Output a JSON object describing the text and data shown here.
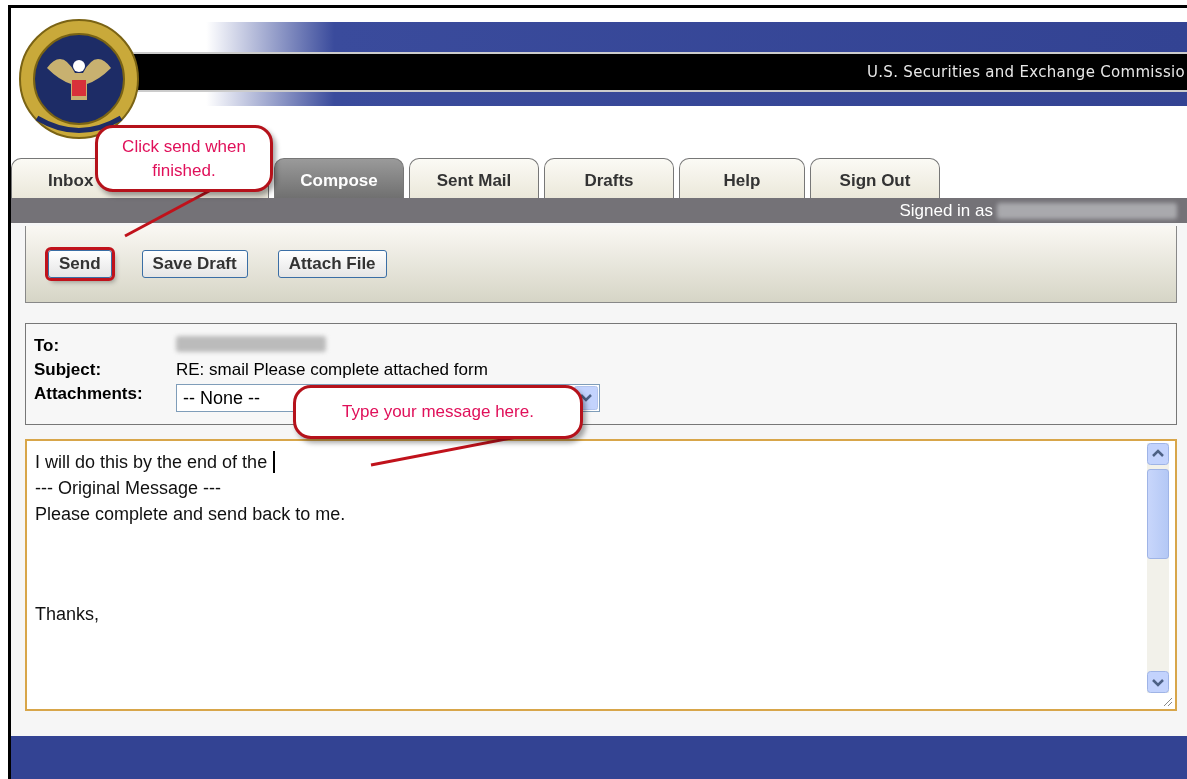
{
  "header": {
    "title": "U.S. Securities and Exchange Commissio"
  },
  "tabs": [
    {
      "label": "Inbox",
      "selected": false
    },
    {
      "label": "Compose",
      "selected": true
    },
    {
      "label": "Sent Mail",
      "selected": false
    },
    {
      "label": "Drafts",
      "selected": false
    },
    {
      "label": "Help",
      "selected": false
    },
    {
      "label": "Sign Out",
      "selected": false
    }
  ],
  "status": {
    "signed_in_label": "Signed in as"
  },
  "toolbar": {
    "buttons": [
      {
        "label": "Send",
        "highlighted": true
      },
      {
        "label": "Save Draft",
        "highlighted": false
      },
      {
        "label": "Attach File",
        "highlighted": false
      }
    ]
  },
  "fields": [
    {
      "label": "To:",
      "kind": "blurred"
    },
    {
      "label": "Subject:",
      "kind": "text",
      "value": "RE: smail Please complete attached form"
    },
    {
      "label": "Attachments:",
      "kind": "select",
      "value": "-- None --"
    }
  ],
  "message": {
    "lines": [
      {
        "text": "I will do this by the end of the",
        "kind": "typing"
      },
      {
        "text": "--- Original Message ---",
        "kind": "plain"
      },
      {
        "text": "Please complete and send back to me.",
        "kind": "plain"
      },
      {
        "text": "Thanks,",
        "kind": "closing"
      }
    ]
  },
  "callouts": [
    {
      "text": "Click send when finished."
    },
    {
      "text": "Type your message here."
    }
  ]
}
